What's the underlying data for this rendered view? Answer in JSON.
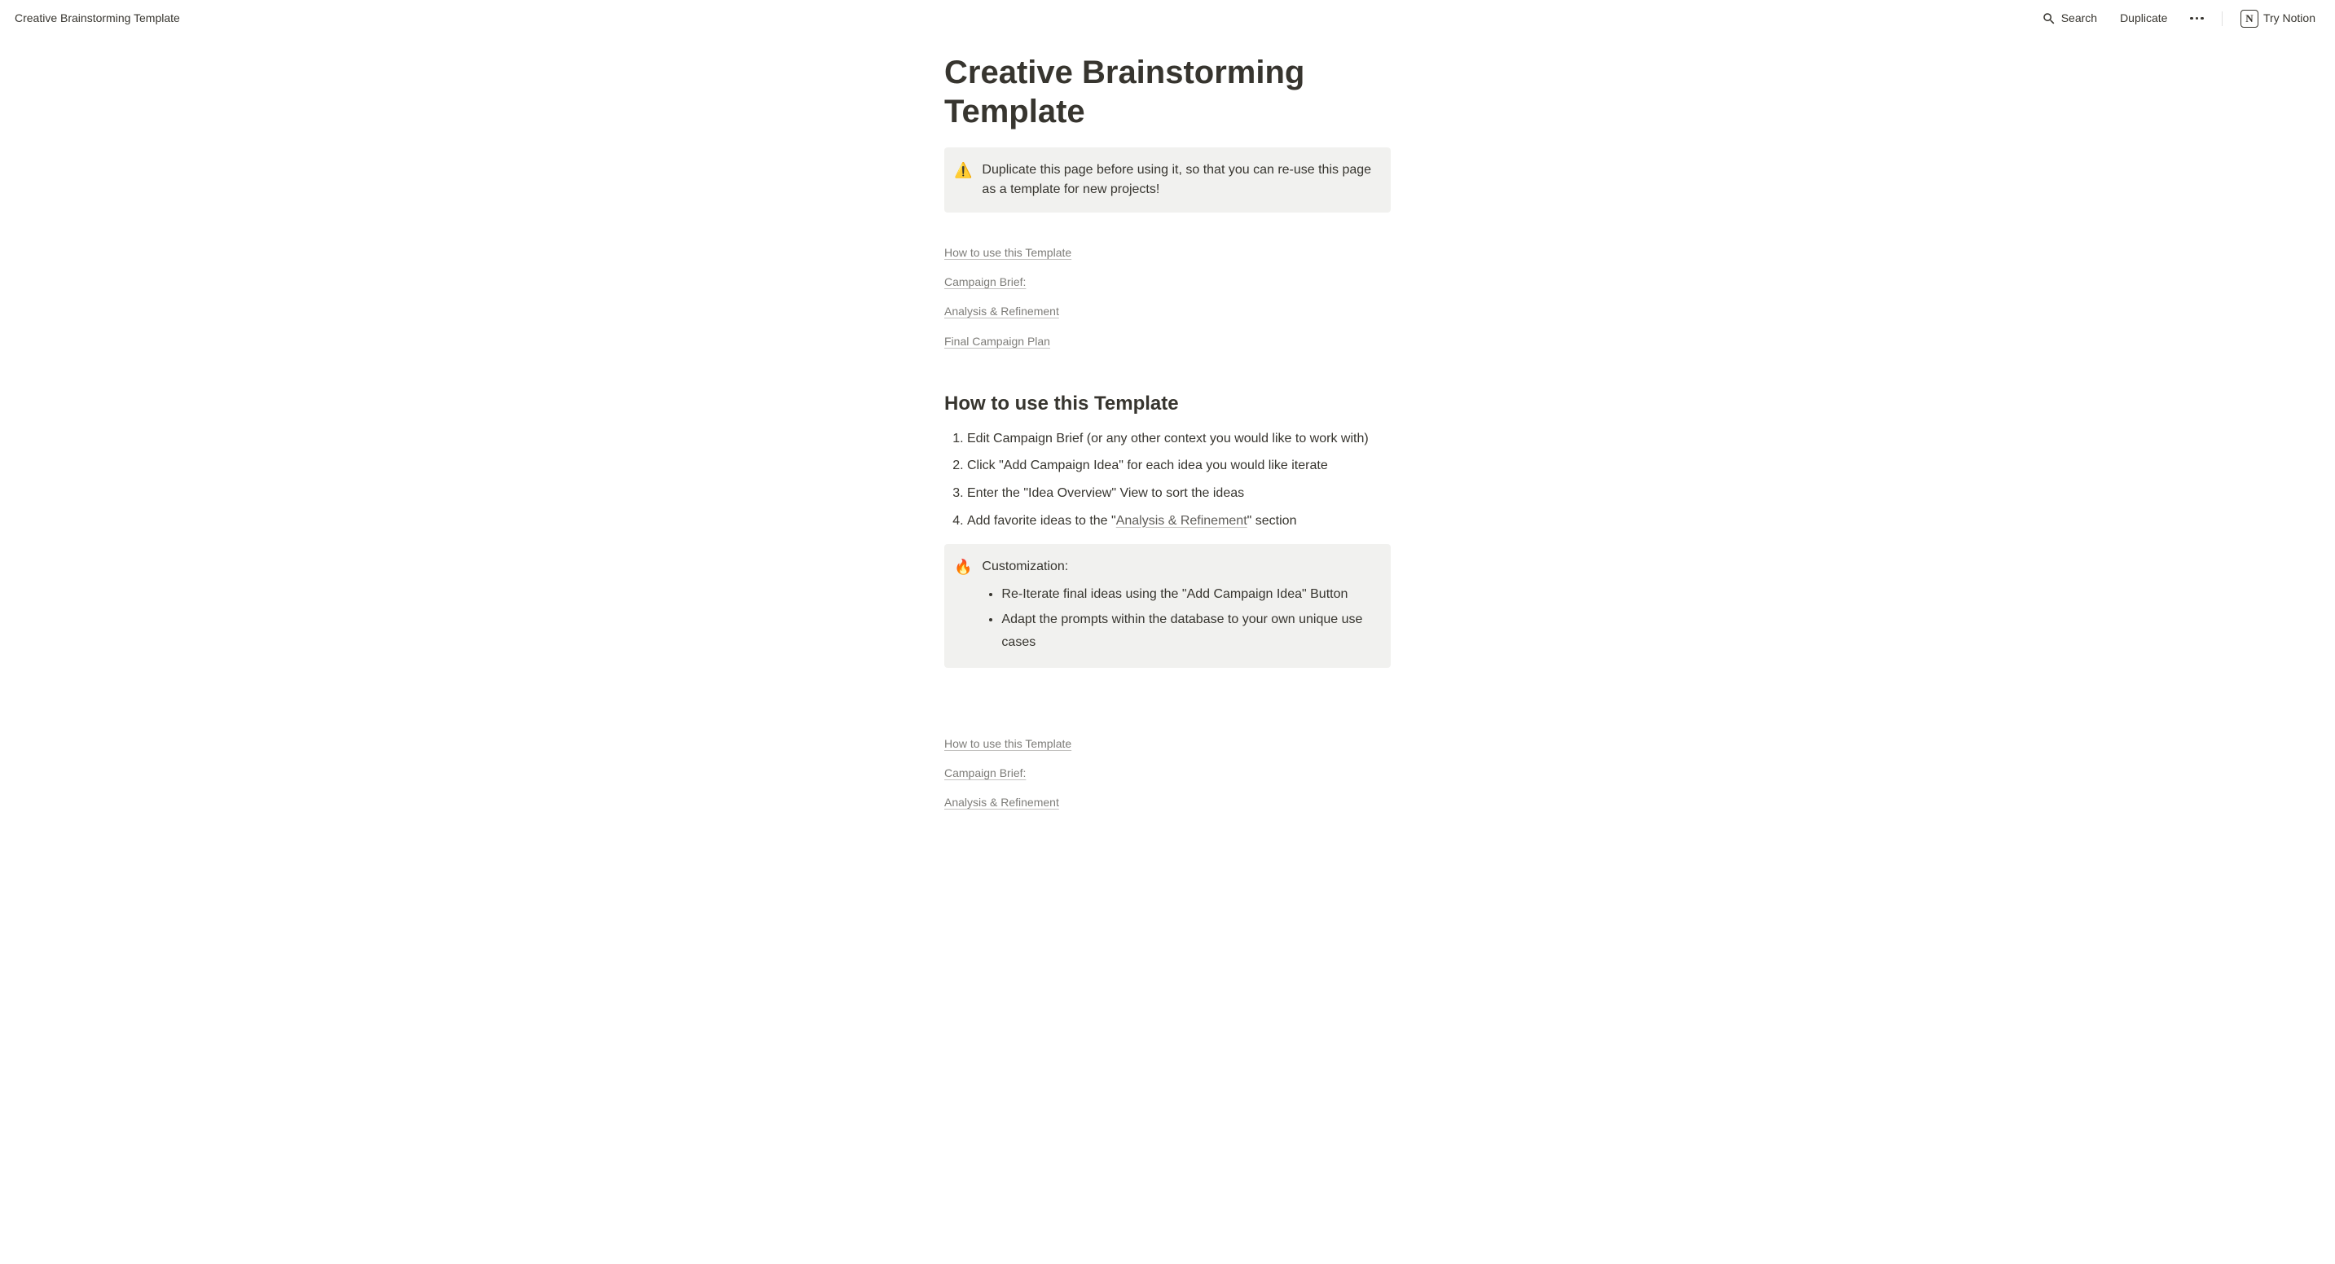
{
  "topbar": {
    "breadcrumb": "Creative Brainstorming Template",
    "search_label": "Search",
    "duplicate_label": "Duplicate",
    "try_notion_label": "Try Notion"
  },
  "page": {
    "title": "Creative Brainstorming Template"
  },
  "callout_warning": {
    "icon": "⚠️",
    "text": "Duplicate this page before using it, so that you can re-use this page as a template for new projects!"
  },
  "toc1": {
    "items": [
      "How to use this Template",
      "Campaign Brief:",
      "Analysis & Refinement",
      "Final Campaign Plan"
    ]
  },
  "section_howto": {
    "heading": "How to use this Template",
    "steps": [
      "Edit Campaign Brief (or any other context you would like to work with)",
      "Click \"Add Campaign Idea\" for each idea you would like iterate",
      "Enter the \"Idea Overview\" View to sort the ideas"
    ],
    "step4_prefix": "Add favorite ideas to the \"",
    "step4_link": "Analysis & Refinement",
    "step4_suffix": "\" section"
  },
  "callout_customization": {
    "icon": "🔥",
    "heading": "Customization:",
    "bullets": [
      "Re-Iterate final ideas using the \"Add Campaign Idea\" Button",
      "Adapt the prompts within the database to your own unique use cases"
    ]
  },
  "toc2": {
    "items": [
      "How to use this Template",
      "Campaign Brief:",
      "Analysis & Refinement"
    ]
  }
}
